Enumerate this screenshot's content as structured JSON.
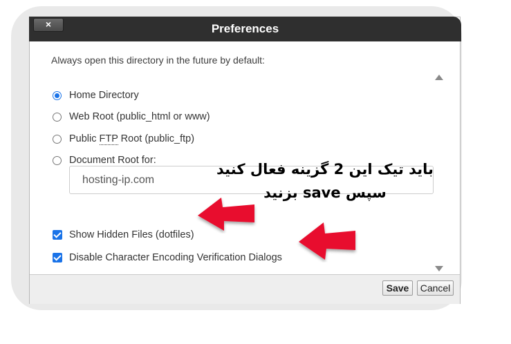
{
  "dialog": {
    "title": "Preferences",
    "close_label": "×"
  },
  "body": {
    "intro": "Always open this directory in the future by default:",
    "radios": [
      {
        "label": "Home Directory",
        "checked": true
      },
      {
        "label": "Web Root (public_html or www)",
        "checked": false
      },
      {
        "label_prefix": "Public ",
        "label_abbr": "FTP",
        "label_suffix": " Root (public_ftp)",
        "checked": false
      },
      {
        "label": "Document Root for:",
        "checked": false
      }
    ],
    "domain_value": "hosting-ip.com",
    "checkboxes": [
      {
        "label": "Show Hidden Files (dotfiles)",
        "checked": true
      },
      {
        "label": "Disable Character Encoding Verification Dialogs",
        "checked": true
      }
    ]
  },
  "footer": {
    "save_label": "Save",
    "cancel_label": "Cancel"
  },
  "annotation": {
    "line1": "باید تیک این 2 گزینه فعال کنید",
    "line2": "سپس save بزنید",
    "arrow_color": "#e8112d"
  },
  "colors": {
    "titlebar": "#2f2f2f",
    "accent": "#1a73e8"
  }
}
